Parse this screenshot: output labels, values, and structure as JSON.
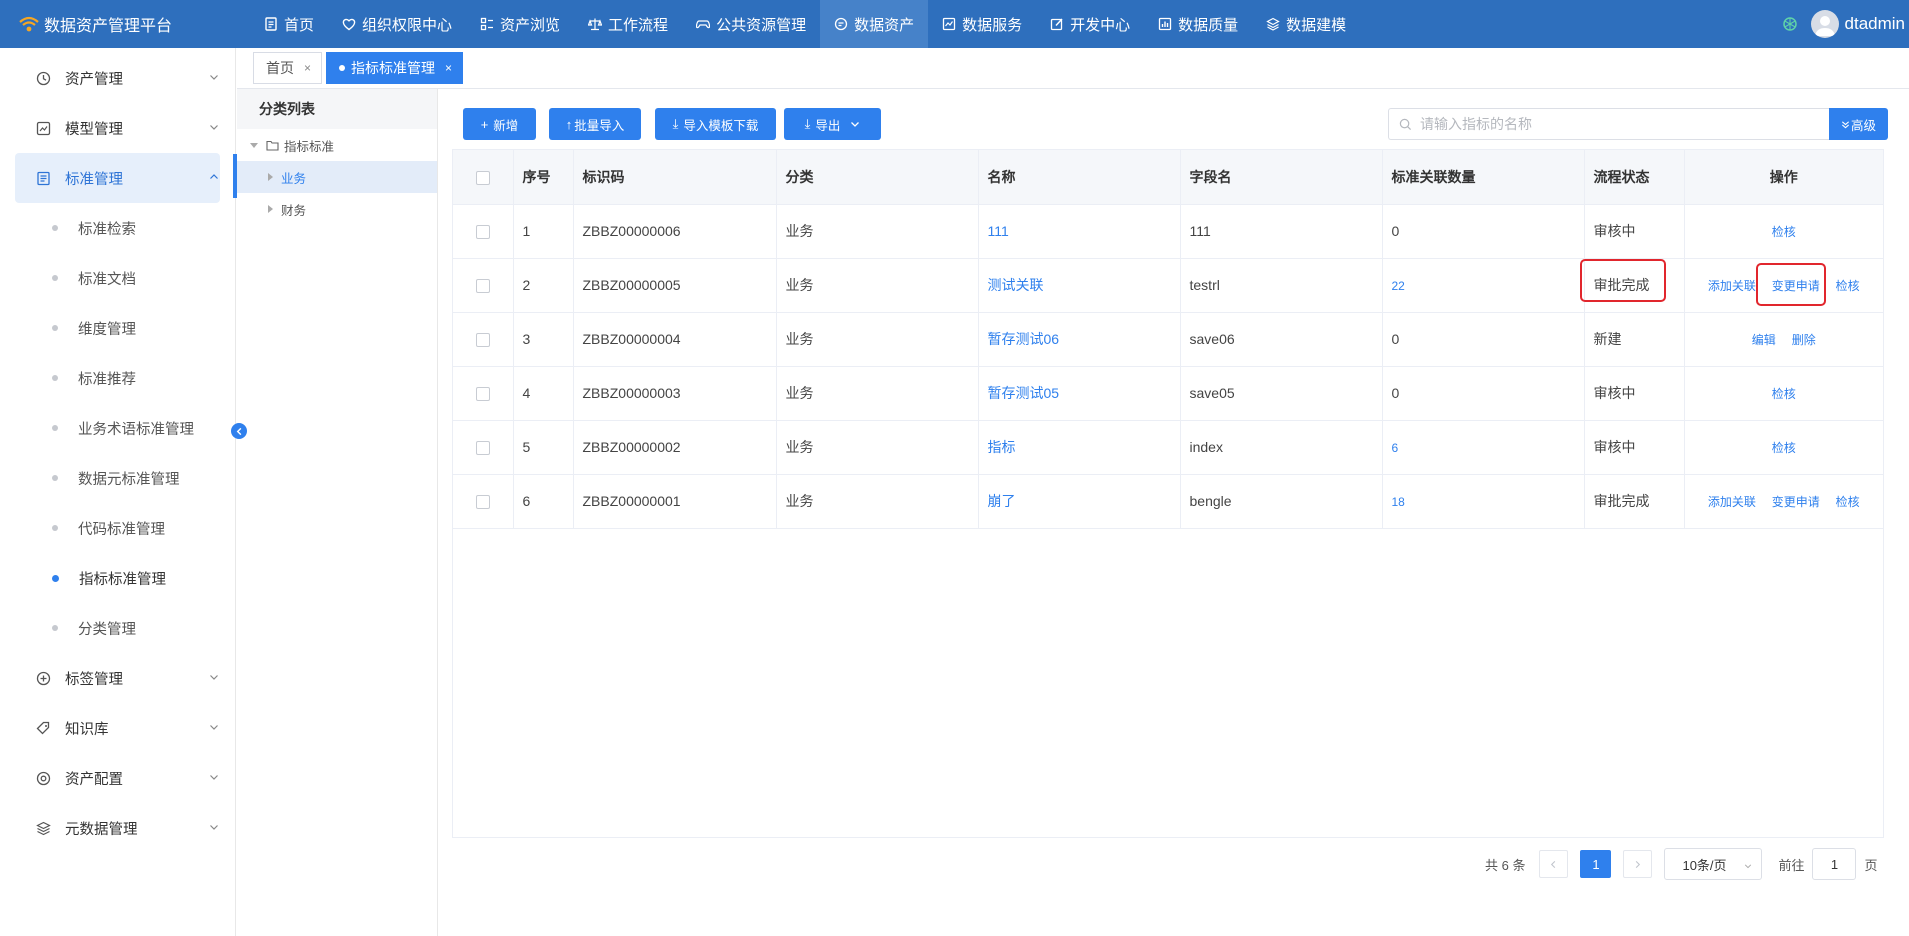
{
  "app": {
    "title": "数据资产管理平台"
  },
  "nav": [
    {
      "label": "首页",
      "icon": "document-icon"
    },
    {
      "label": "组织权限中心",
      "icon": "heart-shield-icon"
    },
    {
      "label": "资产浏览",
      "icon": "grid-list-icon"
    },
    {
      "label": "工作流程",
      "icon": "scale-icon"
    },
    {
      "label": "公共资源管理",
      "icon": "gamepad-icon"
    },
    {
      "label": "数据资产",
      "icon": "chat-circle-icon",
      "active": true
    },
    {
      "label": "数据服务",
      "icon": "chart-box-icon"
    },
    {
      "label": "开发中心",
      "icon": "edit-icon"
    },
    {
      "label": "数据质量",
      "icon": "bar-chart-icon"
    },
    {
      "label": "数据建模",
      "icon": "layers-icon"
    }
  ],
  "user": {
    "name": "dtadmin"
  },
  "sidebar": {
    "groups_top": [
      {
        "label": "资产管理",
        "icon": "clock-icon"
      },
      {
        "label": "模型管理",
        "icon": "line-chart-icon"
      },
      {
        "label": "标准管理",
        "icon": "document-list-icon"
      }
    ],
    "sub_items": [
      {
        "label": "标准检索"
      },
      {
        "label": "标准文档"
      },
      {
        "label": "维度管理"
      },
      {
        "label": "标准推荐"
      },
      {
        "label": "业务术语标准管理"
      },
      {
        "label": "数据元标准管理"
      },
      {
        "label": "代码标准管理"
      },
      {
        "label": "指标标准管理"
      },
      {
        "label": "分类管理"
      }
    ],
    "groups_bottom": [
      {
        "label": "标签管理",
        "icon": "plus-circle-icon"
      },
      {
        "label": "知识库",
        "icon": "tag-icon"
      },
      {
        "label": "资产配置",
        "icon": "target-icon"
      },
      {
        "label": "元数据管理",
        "icon": "layers-icon"
      }
    ]
  },
  "tabs": [
    {
      "label": "首页"
    },
    {
      "label": "指标标准管理"
    }
  ],
  "tree": {
    "title": "分类列表",
    "root": "指标标准",
    "children": [
      "业务",
      "财务"
    ]
  },
  "toolbar": {
    "add": "新增",
    "batch_import": "批量导入",
    "template_download": "导入模板下载",
    "export": "导出",
    "search_placeholder": "请输入指标的名称",
    "advanced": "高级"
  },
  "table": {
    "headers": [
      "序号",
      "标识码",
      "分类",
      "名称",
      "字段名",
      "标准关联数量",
      "流程状态",
      "操作"
    ],
    "rows": [
      {
        "no": "1",
        "code": "ZBBZ00000006",
        "category": "业务",
        "name": "111",
        "field": "111",
        "count": "0",
        "status": "审核中",
        "actions": [
          "检核"
        ]
      },
      {
        "no": "2",
        "code": "ZBBZ00000005",
        "category": "业务",
        "name": "测试关联",
        "field": "testrl",
        "count": "22",
        "status": "审批完成",
        "actions": [
          "添加关联",
          "变更申请",
          "检核"
        ]
      },
      {
        "no": "3",
        "code": "ZBBZ00000004",
        "category": "业务",
        "name": "暂存测试06",
        "field": "save06",
        "count": "0",
        "status": "新建",
        "actions": [
          "编辑",
          "删除"
        ]
      },
      {
        "no": "4",
        "code": "ZBBZ00000003",
        "category": "业务",
        "name": "暂存测试05",
        "field": "save05",
        "count": "0",
        "status": "审核中",
        "actions": [
          "检核"
        ]
      },
      {
        "no": "5",
        "code": "ZBBZ00000002",
        "category": "业务",
        "name": "指标",
        "field": "index",
        "count": "6",
        "status": "审核中",
        "actions": [
          "检核"
        ]
      },
      {
        "no": "6",
        "code": "ZBBZ00000001",
        "category": "业务",
        "name": "崩了",
        "field": "bengle",
        "count": "18",
        "status": "审批完成",
        "actions": [
          "添加关联",
          "变更申请",
          "检核"
        ]
      }
    ]
  },
  "pagination": {
    "total": "共 6 条",
    "current": "1",
    "page_size": "10条/页",
    "goto_prefix": "前往",
    "goto_value": "1",
    "goto_suffix": "页"
  },
  "colors": {
    "primary": "#2f80ed",
    "topbar": "#2e6fbd",
    "highlight": "#e1262d"
  }
}
